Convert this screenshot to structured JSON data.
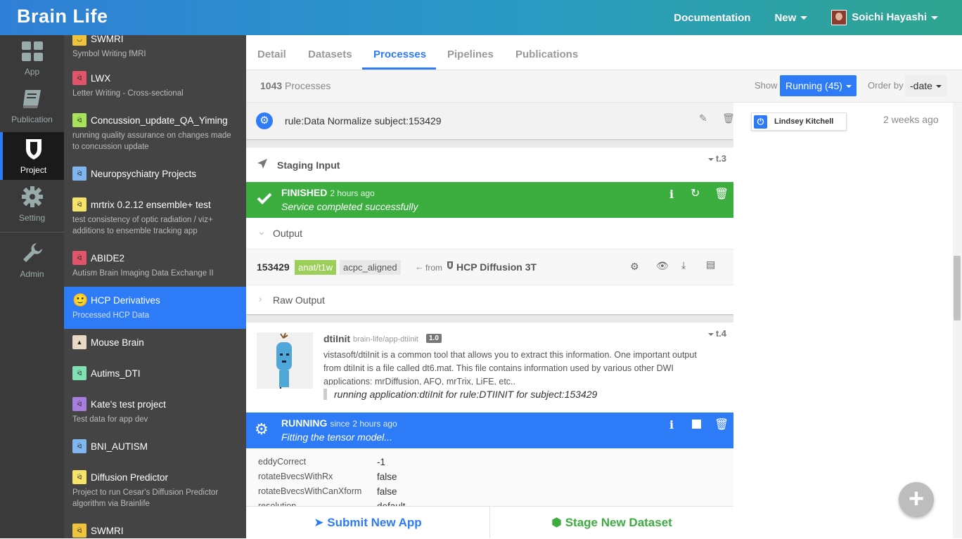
{
  "brand": "Brain Life",
  "nav": {
    "documentation": "Documentation",
    "new": "New",
    "user": "Soichi Hayashi"
  },
  "iconbar": [
    {
      "label": "App",
      "icon": "grid-icon"
    },
    {
      "label": "Publication",
      "icon": "book-icon"
    },
    {
      "label": "Project",
      "icon": "shield-icon"
    },
    {
      "label": "Setting",
      "icon": "gear-icon"
    },
    {
      "label": "Admin",
      "icon": "wrench-icon"
    }
  ],
  "projects": [
    {
      "name": "SWMRI",
      "desc": "Symbol Writing fMRI"
    },
    {
      "name": "LWX",
      "desc": "Letter Writing - Cross-sectional"
    },
    {
      "name": "Concussion_update_QA_Yiming",
      "desc": "running quality assurance on changes made to concussion update"
    },
    {
      "name": "Neuropsychiatry Projects",
      "desc": ""
    },
    {
      "name": "mrtrix 0.2.12 ensemble+ test",
      "desc": "test consistency of optic radiation / viz+ additions to ensemble tracking app"
    },
    {
      "name": "ABIDE2",
      "desc": "Autism Brain Imaging Data Exchange II"
    },
    {
      "name": "HCP Derivatives",
      "desc": "Processed HCP Data"
    },
    {
      "name": "Mouse Brain",
      "desc": ""
    },
    {
      "name": "Autims_DTI",
      "desc": ""
    },
    {
      "name": "Kate's test project",
      "desc": "Test data for app dev"
    },
    {
      "name": "BNI_AUTISM",
      "desc": ""
    },
    {
      "name": "Diffusion Predictor",
      "desc": "Project to run Cesar's Diffusion Predictor algorithm via Brainlife"
    },
    {
      "name": "SWMRI",
      "desc": ""
    }
  ],
  "tabs": [
    "Detail",
    "Datasets",
    "Processes",
    "Pipelines",
    "Publications"
  ],
  "header": {
    "count": "1043",
    "count_label": "Processes",
    "show_label": "Show",
    "show_value": "Running (45)",
    "order_label": "Order by",
    "order_value": "-date"
  },
  "instance": {
    "title": "rule:Data Normalize subject:153429",
    "user": "Lindsey Kitchell",
    "ago": "2 weeks ago"
  },
  "task1": {
    "title": "Staging Input",
    "tid": "t.3",
    "status": "FINISHED",
    "when": "2 hours ago",
    "message": "Service completed successfully",
    "output_label": "Output",
    "subject": "153429",
    "datatype": "anat/t1w",
    "tag": "acpc_aligned",
    "from_label": "from",
    "from_name": "HCP Diffusion 3T",
    "raw_label": "Raw Output"
  },
  "task2": {
    "app_name": "dtiInit",
    "app_repo": "brain-life/app-dtiinit",
    "version": "1.0",
    "tid": "t.4",
    "desc": "vistasoft/dtiInit is a common tool that allows you to extract this information. One important output from dtiInit is a file called dt6.mat. This file contains information used by various other DWI applications: mrDiffusion, AFQ, mrTrix, LiFE, etc..",
    "running_note": "running application:dtiInit for rule:DTIINIT for subject:153429",
    "status": "RUNNING",
    "since_label": "since",
    "when": "2 hours ago",
    "message": "Fitting the tensor model...",
    "config": [
      {
        "k": "eddyCorrect",
        "v": "-1"
      },
      {
        "k": "rotateBvecsWithRx",
        "v": "false"
      },
      {
        "k": "rotateBvecsWithCanXform",
        "v": "false"
      },
      {
        "k": "resolution",
        "v": "default"
      }
    ]
  },
  "bottom": {
    "submit": "Submit New App",
    "stage": "Stage New Dataset"
  },
  "colors": {
    "primary": "#2d7bf6",
    "finished": "#3cad3f",
    "running": "#2d7bf6",
    "datatype": "#9ccf5a"
  }
}
